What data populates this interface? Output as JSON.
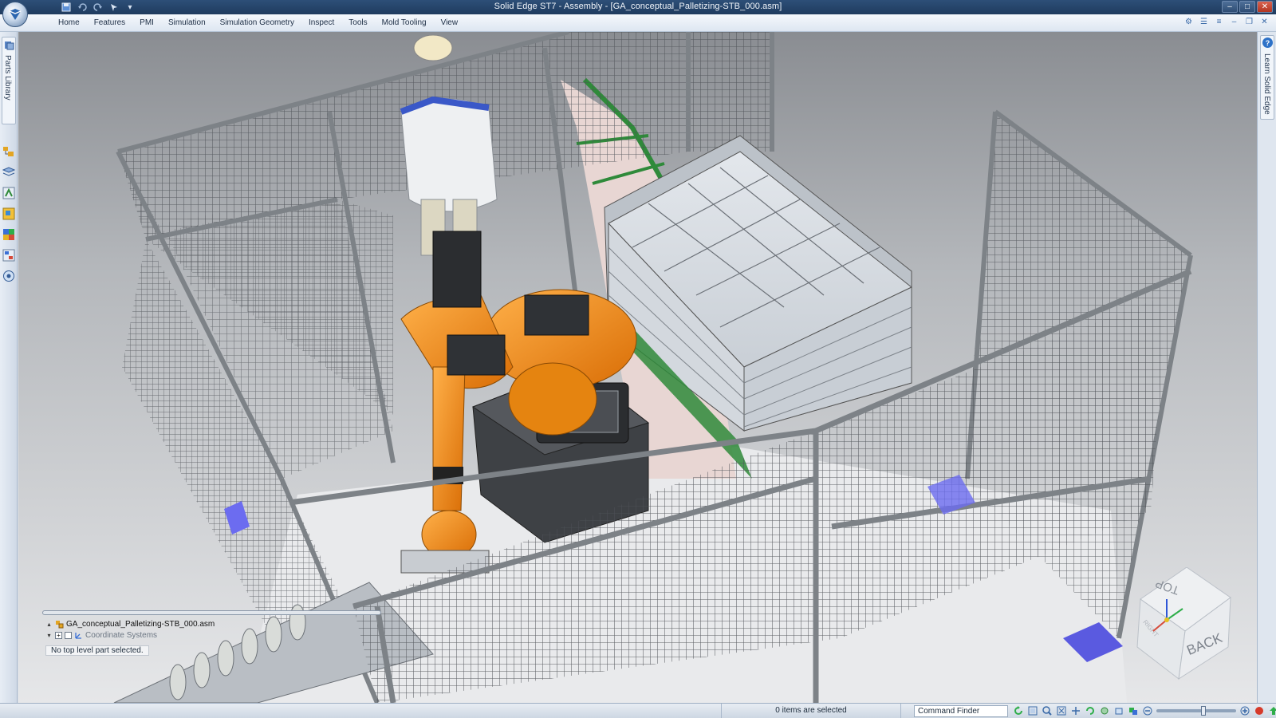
{
  "window": {
    "title": "Solid Edge ST7 - Assembly - [GA_conceptual_Palletizing-STB_000.asm]"
  },
  "menu": {
    "items": [
      "Home",
      "Features",
      "PMI",
      "Simulation",
      "Simulation Geometry",
      "Inspect",
      "Tools",
      "Mold Tooling",
      "View"
    ]
  },
  "left_panel": {
    "tab_label": "Parts Library"
  },
  "right_panel": {
    "tab_label": "Learn Solid Edge"
  },
  "pathfinder": {
    "assembly_name": "GA_conceptual_Palletizing-STB_000.asm",
    "child_item": "Coordinate Systems",
    "status": "No top level part selected."
  },
  "viewcube": {
    "top_label": "TOP",
    "back_label": "BACK",
    "side_label": "RIGHT"
  },
  "statusbar": {
    "selection_message": "0 items are selected",
    "command_finder": "Command Finder"
  },
  "colors": {
    "robot": "#f08a12",
    "fence": "#5a5e63",
    "boxes": "#cfd5dc",
    "pallet_rail": "#2f8a3a",
    "mount_plate": "#6c6cf0"
  },
  "icons": [
    "app-menu-icon",
    "save-icon",
    "undo-icon",
    "redo-icon",
    "help-icon"
  ]
}
